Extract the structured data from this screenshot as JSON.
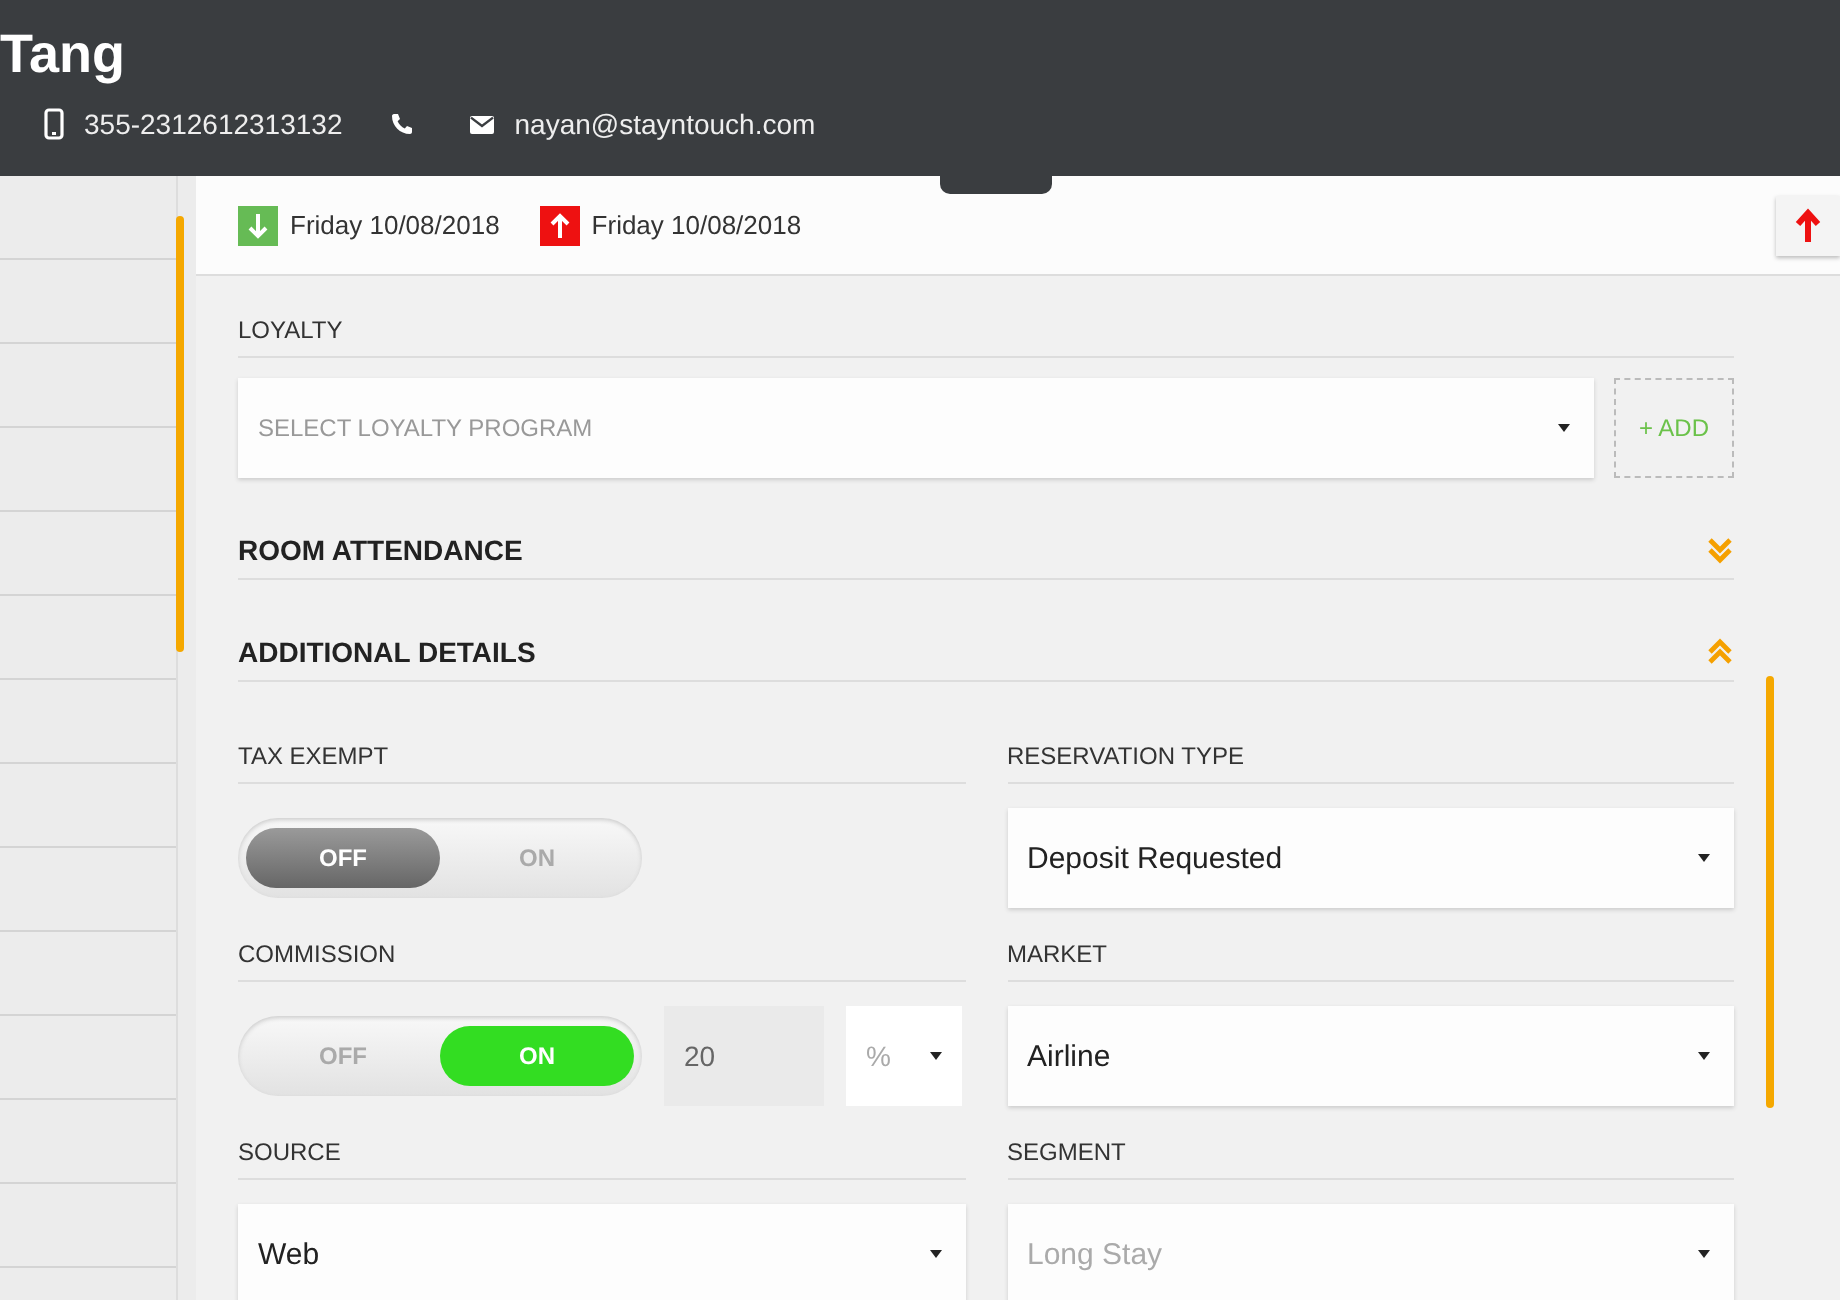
{
  "header": {
    "name": "Tang",
    "phone": "355-2312612313132",
    "email": "nayan@stayntouch.com"
  },
  "dates": [
    {
      "kind": "arrival",
      "date": "Friday 10/08/2018"
    },
    {
      "kind": "departure",
      "date": "Friday 10/08/2018"
    }
  ],
  "loyalty": {
    "label": "LOYALTY",
    "placeholder": "SELECT LOYALTY PROGRAM",
    "add_label": "+ ADD"
  },
  "sections": [
    {
      "title": "ROOM ATTENDANCE",
      "expanded": false
    },
    {
      "title": "ADDITIONAL DETAILS",
      "expanded": true
    }
  ],
  "fields": [
    {
      "kind": "toggle",
      "label": "TAX EXEMPT",
      "off_label": "OFF",
      "on_label": "ON",
      "on": false
    },
    {
      "kind": "select",
      "label": "RESERVATION TYPE",
      "value": "Deposit Requested",
      "disabled": false
    },
    {
      "kind": "toggle",
      "label": "COMMISSION",
      "off_label": "OFF",
      "on_label": "ON",
      "on": true,
      "amount": "20",
      "unit": "%"
    },
    {
      "kind": "select",
      "label": "MARKET",
      "value": "Airline",
      "disabled": false
    },
    {
      "kind": "select",
      "label": "SOURCE",
      "value": "Web",
      "disabled": false
    },
    {
      "kind": "select",
      "label": "SEGMENT",
      "value": "Long Stay",
      "disabled": true
    }
  ]
}
